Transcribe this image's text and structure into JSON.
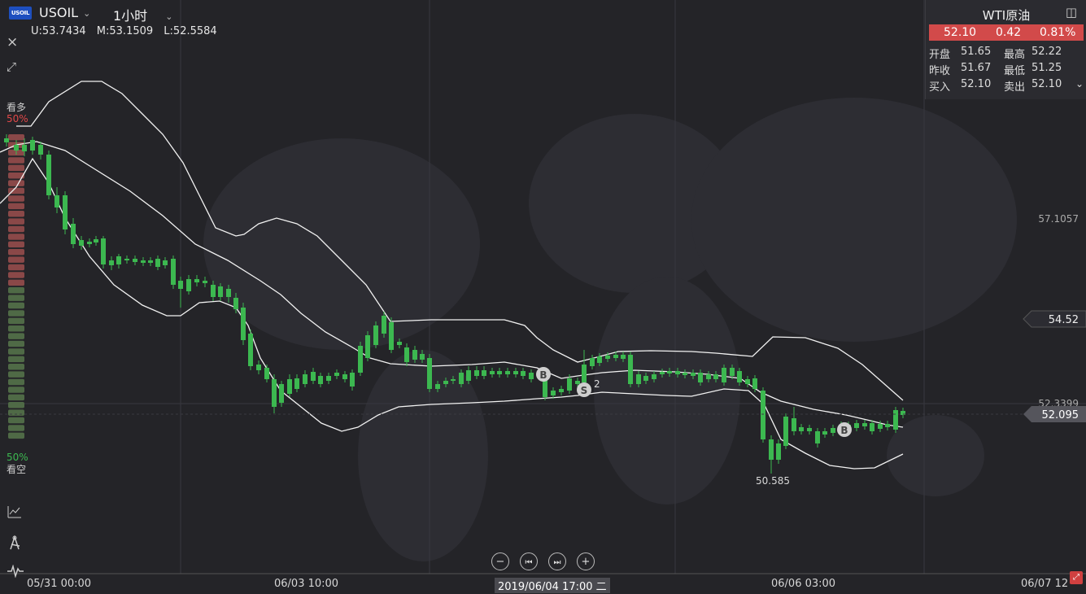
{
  "header": {
    "logo_text": "USOIL",
    "symbol": "USOIL",
    "timeframe": "1小时",
    "ohl": {
      "u": "U:53.7434",
      "m": "M:53.1509",
      "l": "L:52.5584"
    }
  },
  "sentiment": {
    "bull_label": "看多",
    "bull_pct": "50%",
    "bear_pct": "50%",
    "bear_label": "看空"
  },
  "quote_panel": {
    "title": "WTI原油",
    "price": "52.10",
    "change": "0.42",
    "change_pct": "0.81%",
    "open_label": "开盘",
    "open": "51.65",
    "high_label": "最高",
    "high": "52.22",
    "prev_close_label": "昨收",
    "prev_close": "51.67",
    "low_label": "最低",
    "low": "51.25",
    "bid_label": "买入",
    "bid": "52.10",
    "ask_label": "卖出",
    "ask": "52.10"
  },
  "y_labels": {
    "level1": "57.1057",
    "level2": "54.52",
    "level3": "52.3399",
    "current": "52.095",
    "low_annotation": "50.585",
    "marker_count": "2"
  },
  "x_labels": {
    "t1": "05/31 00:00",
    "t2": "06/03 10:00",
    "t3": "2019/06/04 17:00 二",
    "t4": "06/06 03:00",
    "t5": "06/07 12"
  },
  "trade_markers": [
    "B",
    "S",
    "B"
  ],
  "colors": {
    "background": "#242428",
    "up": "#e04848",
    "down": "#3cb850",
    "band": "#ffffff",
    "quote_bg": "#d24a4a"
  },
  "icons": [
    "close-icon",
    "expand-icon",
    "chart-type-icon",
    "drawing-tool-icon",
    "indicator-icon",
    "panel-toggle-icon",
    "minus-icon",
    "prev-icon",
    "next-icon",
    "plus-icon"
  ]
}
